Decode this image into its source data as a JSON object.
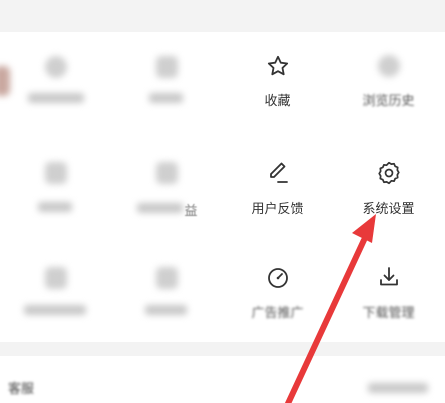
{
  "menu": {
    "favorites": "收藏",
    "history": "浏览历史",
    "feedback": "用户反馈",
    "settings": "系统设置",
    "ad_promo": "广告推广",
    "downloads": "下载管理",
    "public_welfare_partial": "益"
  },
  "bottom": {
    "left_label": "客服"
  },
  "colors": {
    "arrow": "#e8393a",
    "text": "#333333"
  },
  "icons": [
    "star-icon",
    "clock-icon",
    "pencil-icon",
    "gear-icon",
    "gauge-icon",
    "download-icon"
  ]
}
